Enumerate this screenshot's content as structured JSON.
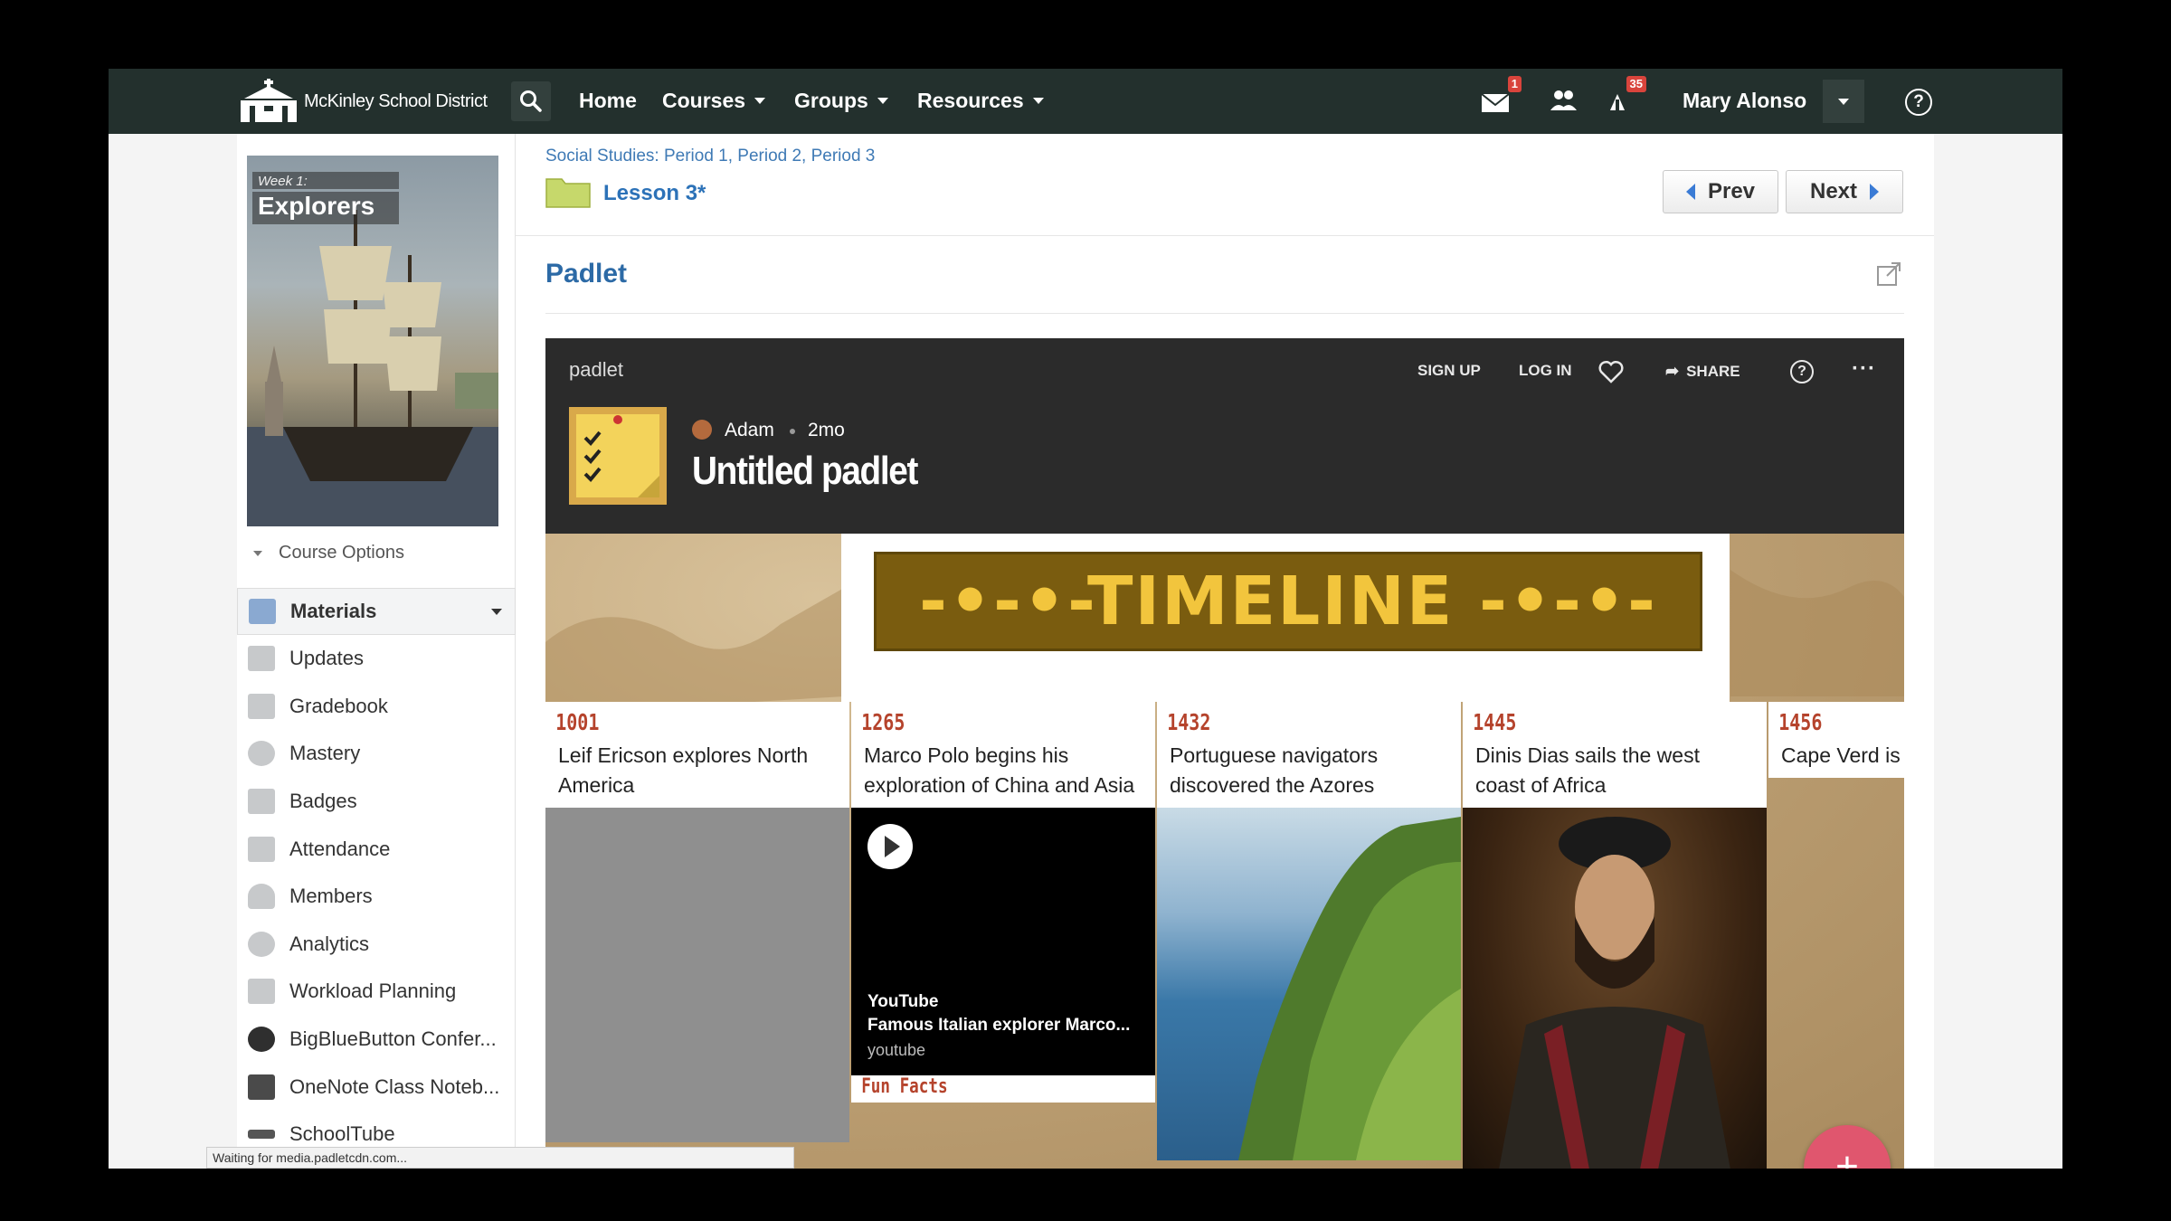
{
  "nav": {
    "brand": "McKinley School District",
    "items": [
      {
        "label": "Home"
      },
      {
        "label": "Courses"
      },
      {
        "label": "Groups"
      },
      {
        "label": "Resources"
      }
    ],
    "badges": {
      "messages": "1",
      "notifications": "35"
    },
    "user_name": "Mary Alonso",
    "icons": [
      "search-icon",
      "envelope-icon",
      "people-icon",
      "bell-icon",
      "chevron-down-icon",
      "help-icon"
    ]
  },
  "course": {
    "week": "Week 1:",
    "title": "Explorers",
    "options_label": "Course Options"
  },
  "sidebar": {
    "items": [
      {
        "label": "Materials"
      },
      {
        "label": "Updates"
      },
      {
        "label": "Gradebook"
      },
      {
        "label": "Mastery"
      },
      {
        "label": "Badges"
      },
      {
        "label": "Attendance"
      },
      {
        "label": "Members"
      },
      {
        "label": "Analytics"
      },
      {
        "label": "Workload Planning"
      },
      {
        "label": "BigBlueButton Confer..."
      },
      {
        "label": "OneNote Class Noteb..."
      },
      {
        "label": "SchoolTube"
      }
    ]
  },
  "main": {
    "breadcrumb": "Social Studies: Period 1, Period 2, Period 3",
    "lesson": "Lesson 3*",
    "prev_label": "Prev",
    "next_label": "Next",
    "section_title": "Padlet"
  },
  "padlet": {
    "brand": "padlet",
    "actions": {
      "sign_up": "SIGN UP",
      "log_in": "LOG IN",
      "share": "SHARE"
    },
    "author": "Adam",
    "time": "2mo",
    "title": "Untitled padlet",
    "banner": "-•-•-TIMELINE -•-•-",
    "cards": [
      {
        "year": "1001",
        "text": "Leif Ericson explores North America"
      },
      {
        "year": "1265",
        "text": "Marco Polo begins his exploration of China and Asia"
      },
      {
        "year": "1432",
        "text": "Portuguese navigators discovered the Azores"
      },
      {
        "year": "1445",
        "text": "Dinis Dias sails the west coast of Africa"
      },
      {
        "year": "1456",
        "text": "Cape Verd is explored by"
      }
    ],
    "video": {
      "source_title": "YouTube",
      "description": "Famous Italian explorer Marco...",
      "domain": "youtube"
    },
    "fun_facts": "Fun Facts",
    "add_label": "+"
  },
  "status_bar": "Waiting for media.padletcdn.com..."
}
